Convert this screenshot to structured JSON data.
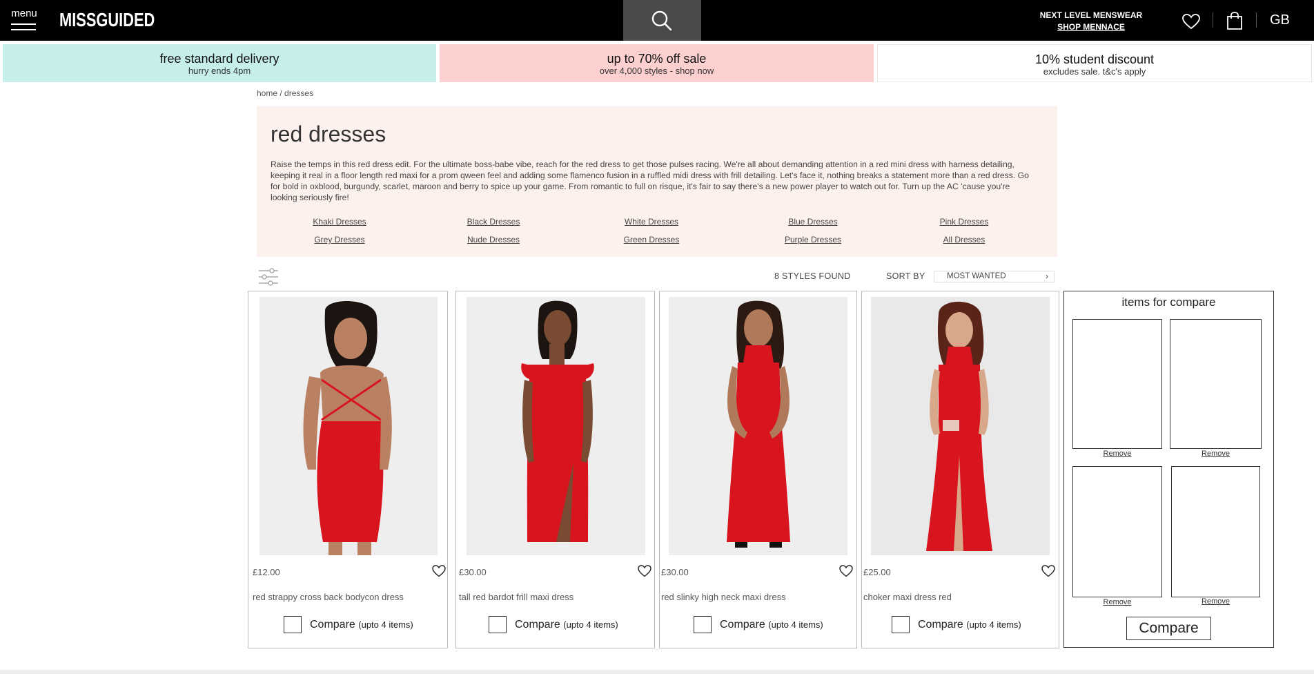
{
  "header": {
    "menu_label": "menu",
    "logo": "MISSGUIDED",
    "menswear_title": "NEXT LEVEL MENSWEAR",
    "menswear_link": "SHOP MENNACE",
    "country": "GB"
  },
  "promos": [
    {
      "title": "free standard delivery",
      "subtitle": "hurry ends 4pm",
      "bg": "#c6efec"
    },
    {
      "title": "up to 70% off sale",
      "subtitle": "over 4,000 styles - shop now",
      "bg": "#fdd0d0"
    },
    {
      "title": "10% student discount",
      "subtitle": "excludes sale. t&c's apply",
      "bg": "#ffffff"
    }
  ],
  "breadcrumb": {
    "home": "home",
    "sep": " / ",
    "current": "dresses"
  },
  "category": {
    "title": "red dresses",
    "description": "Raise the temps in this red dress edit. For the ultimate boss-babe vibe, reach for the red dress to get those pulses racing. We're all about demanding attention in a red mini dress with harness detailing, keeping it real in a floor length red maxi for a prom qween feel and adding some flamenco fusion in a ruffled midi dress with frill detailing. Let's face it, nothing breaks a statement more than a red dress. Go for bold in oxblood, burgundy, scarlet, maroon and berry to spice up your game. From romantic to full on risque, it's fair to say there's a new power player to watch out for. Turn up the AC 'cause you're looking seriously fire!",
    "links": [
      "Khaki Dresses",
      "Black Dresses",
      "White Dresses",
      "Blue Dresses",
      "Pink Dresses",
      "Grey Dresses",
      "Nude Dresses",
      "Green Dresses",
      "Purple Dresses",
      "All Dresses"
    ]
  },
  "toolbar": {
    "styles_found": "8 STYLES FOUND",
    "sort_label": "SORT BY",
    "sort_value": "MOST WANTED"
  },
  "products": [
    {
      "price": "£12.00",
      "name": "red strappy cross back bodycon dress",
      "compare_label": "Compare",
      "compare_note": "(upto 4 items)"
    },
    {
      "price": "£30.00",
      "name": "tall red bardot frill maxi dress",
      "compare_label": "Compare",
      "compare_note": "(upto 4 items)"
    },
    {
      "price": "£30.00",
      "name": "red slinky high neck maxi dress",
      "compare_label": "Compare",
      "compare_note": "(upto 4 items)"
    },
    {
      "price": "£25.00",
      "name": "choker maxi dress red",
      "compare_label": "Compare",
      "compare_note": "(upto 4 items)"
    }
  ],
  "compare_panel": {
    "title": "items for compare",
    "remove_label": "Remove",
    "button": "Compare"
  },
  "colors": {
    "header_bg": "#000000",
    "search_bg": "#4a4a4a",
    "category_bg": "#fdf1ee",
    "dress_red": "#d8141f"
  }
}
